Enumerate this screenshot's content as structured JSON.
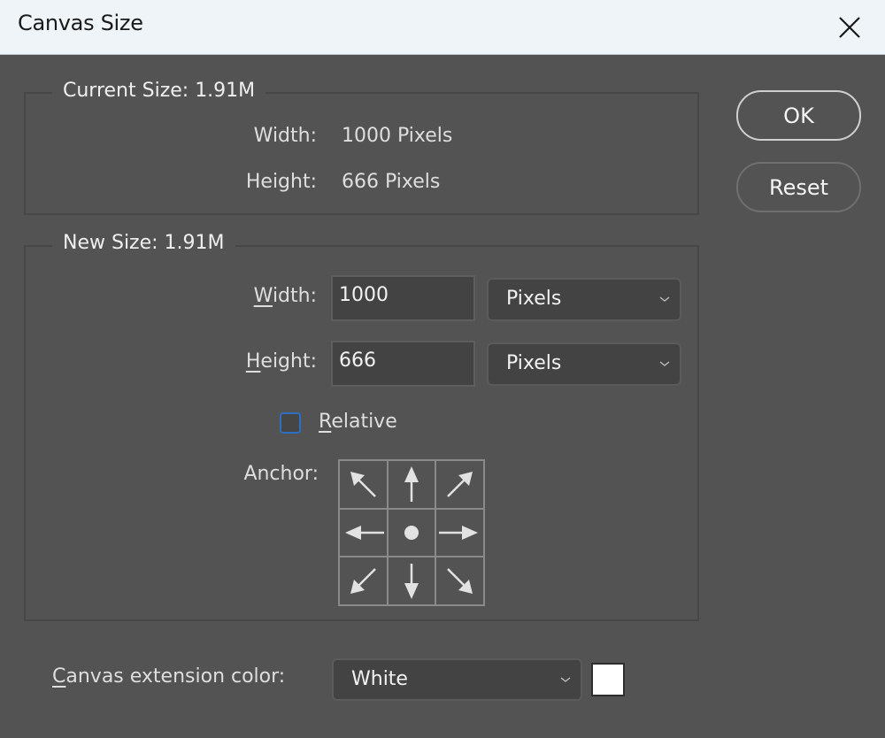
{
  "window": {
    "title": "Canvas Size",
    "close_icon": "close-icon"
  },
  "current_size": {
    "legend": "Current Size: 1.91M",
    "width_label": "Width:",
    "width_value": "1000 Pixels",
    "height_label": "Height:",
    "height_value": "666 Pixels"
  },
  "new_size": {
    "legend": "New Size: 1.91M",
    "width_label_mnemonic": "W",
    "width_label_rest": "idth:",
    "width_value": "1000",
    "width_unit": "Pixels",
    "height_label_mnemonic": "H",
    "height_label_rest": "eight:",
    "height_value": "666",
    "height_unit": "Pixels",
    "relative_label_mnemonic": "R",
    "relative_label_rest": "elative",
    "relative_checked": false,
    "anchor_label": "Anchor:",
    "anchor_cells": [
      {
        "name": "top-left",
        "icon": "arrow-up-left-icon"
      },
      {
        "name": "top",
        "icon": "arrow-up-icon"
      },
      {
        "name": "top-right",
        "icon": "arrow-up-right-icon"
      },
      {
        "name": "left",
        "icon": "arrow-left-icon"
      },
      {
        "name": "center",
        "icon": "dot-icon",
        "selected": true
      },
      {
        "name": "right",
        "icon": "arrow-right-icon"
      },
      {
        "name": "bottom-left",
        "icon": "arrow-down-left-icon"
      },
      {
        "name": "bottom",
        "icon": "arrow-down-icon"
      },
      {
        "name": "bottom-right",
        "icon": "arrow-down-right-icon"
      }
    ]
  },
  "extension": {
    "label_mnemonic": "C",
    "label_rest": "anvas extension color:",
    "value": "White",
    "swatch_color": "#ffffff"
  },
  "buttons": {
    "ok": "OK",
    "reset": "Reset"
  },
  "colors": {
    "dialog_bg": "#535353",
    "titlebar_bg": "#eff4f9",
    "checkbox_accent": "#2f6fc0"
  }
}
